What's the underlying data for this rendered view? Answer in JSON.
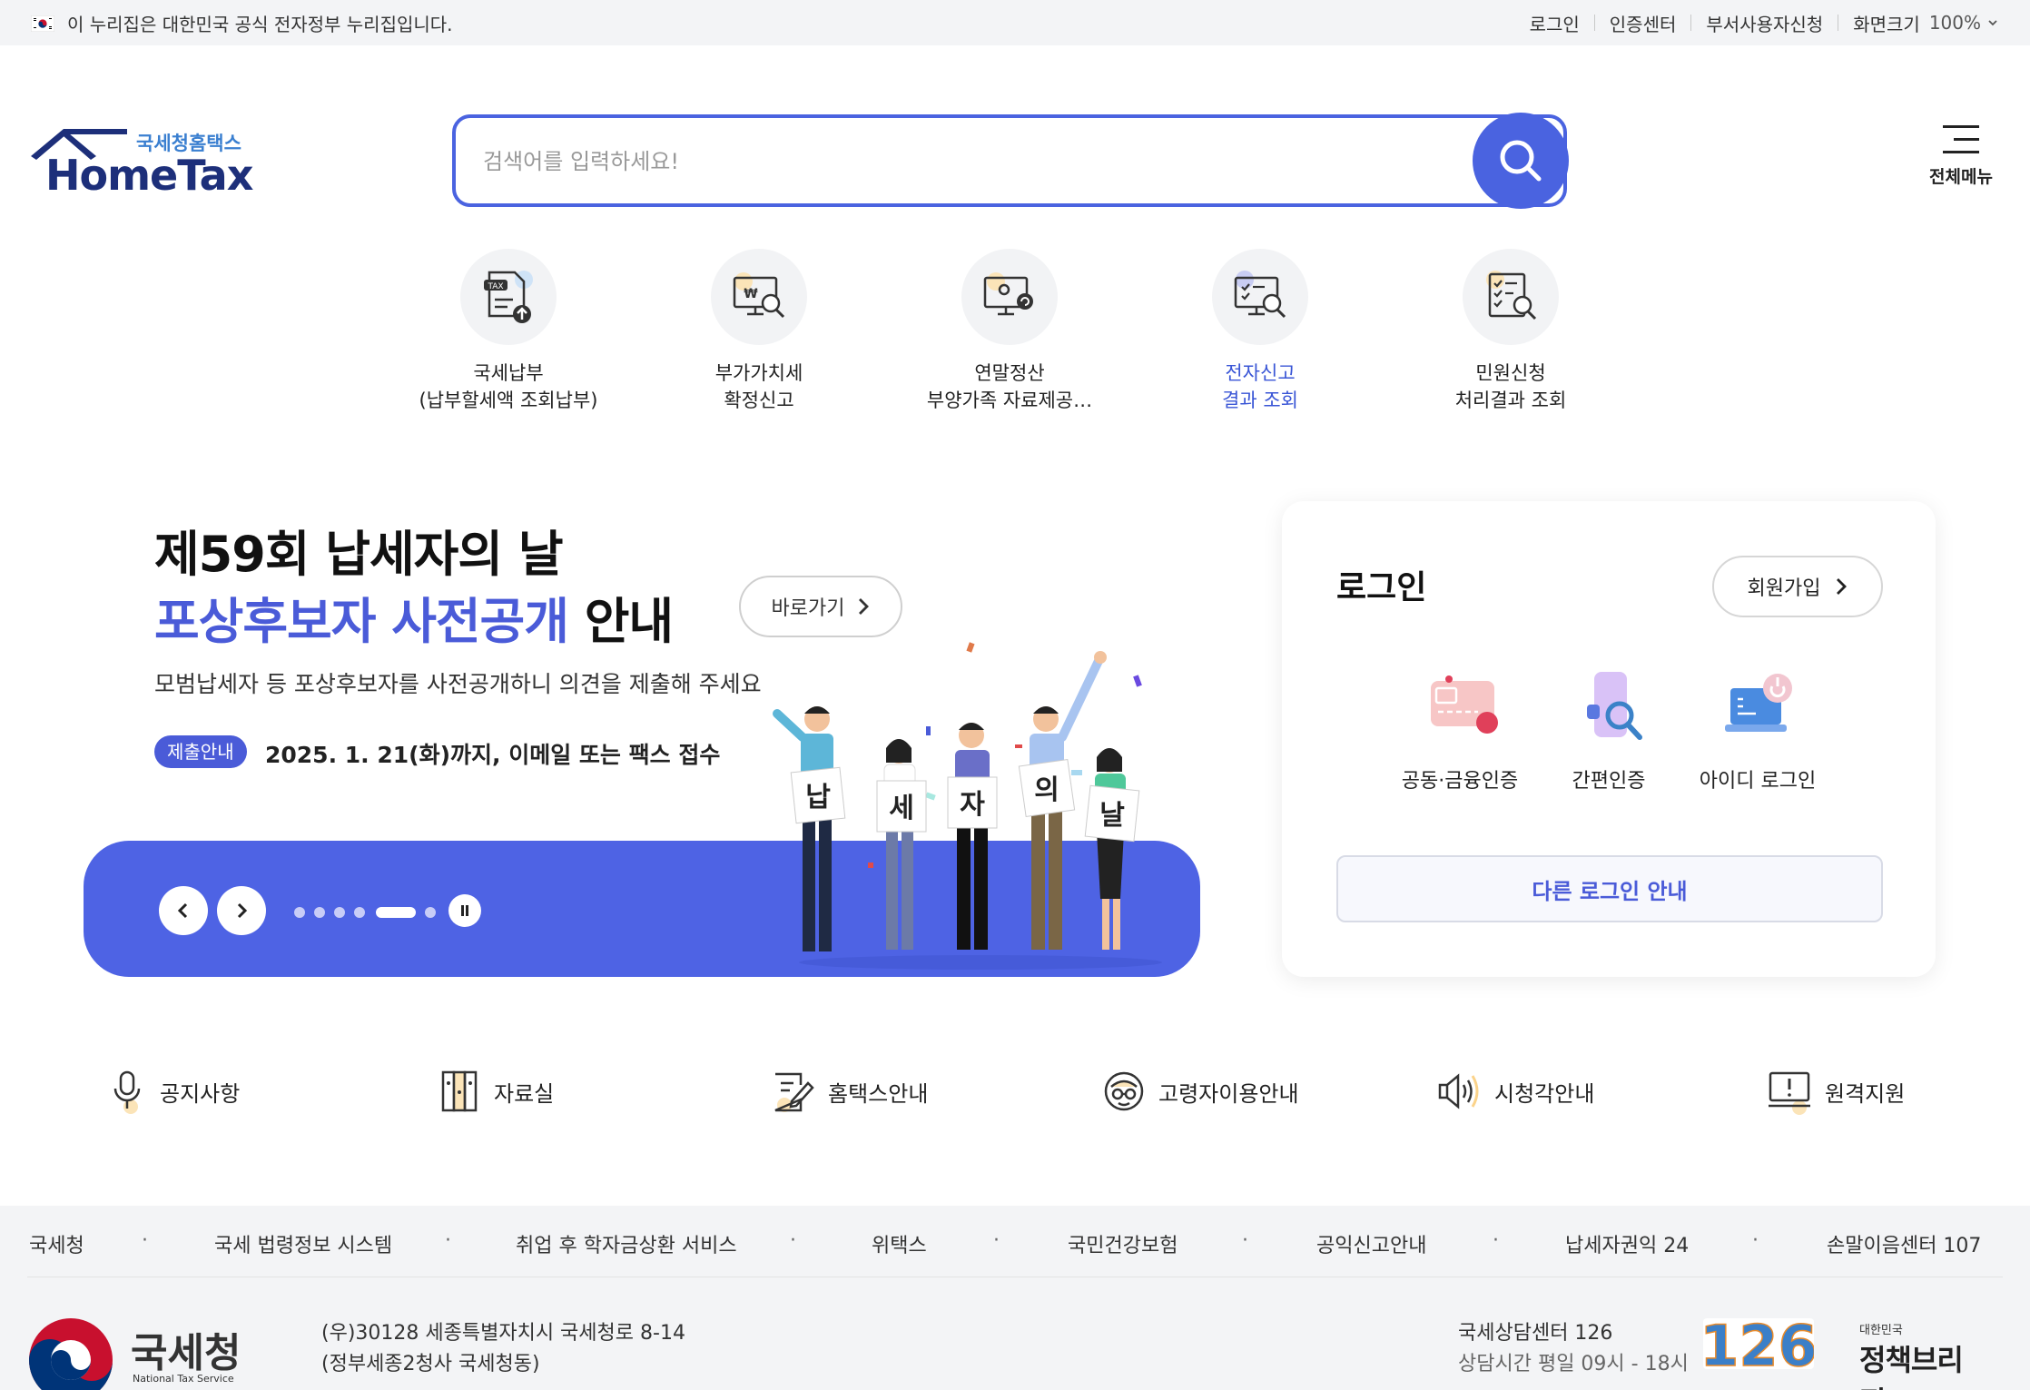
{
  "gov_bar": {
    "notice": "이 누리집은 대한민국 공식 전자정부 누리집입니다.",
    "links": [
      "로그인",
      "인증센터",
      "부서사용자신청"
    ],
    "zoom_label": "화면크기",
    "zoom_value": "100%"
  },
  "header": {
    "logo_sub": "국세청홈택스",
    "logo_main": "HomeTax",
    "search_placeholder": "검색어를 입력하세요!",
    "menu_label": "전체메뉴"
  },
  "quick_menu": [
    {
      "line1": "국세납부",
      "line2": "(납부할세액 조회납부)",
      "icon": "tax-payment-icon"
    },
    {
      "line1": "부가가치세",
      "line2": "확정신고",
      "icon": "vat-report-icon"
    },
    {
      "line1": "연말정산",
      "line2": "부양가족 자료제공…",
      "icon": "year-end-settlement-icon"
    },
    {
      "line1": "전자신고",
      "line2": "결과 조회",
      "icon": "e-filing-result-icon",
      "highlight": true
    },
    {
      "line1": "민원신청",
      "line2": "처리결과 조회",
      "icon": "civil-petition-icon"
    }
  ],
  "banner": {
    "title_line1": "제59회 납세자의 날",
    "title_line2_accent": "포상후보자 사전공개",
    "title_line2_rest": " 안내",
    "goto_label": "바로가기",
    "description": "모범납세자 등 포상후보자를 사전공개하니 의견을 제출해 주세요",
    "badge": "제출안내",
    "badge_text": "2025. 1. 21(화)까지, 이메일 또는 팩스 접수",
    "signs": [
      "납",
      "세",
      "자",
      "의",
      "날"
    ],
    "slide_count": 6,
    "active_slide": 5
  },
  "login": {
    "title": "로그인",
    "join_label": "회원가입",
    "methods": [
      {
        "label": "공동·금융인증",
        "icon": "certificate-icon"
      },
      {
        "label": "간편인증",
        "icon": "simple-auth-icon"
      },
      {
        "label": "아이디 로그인",
        "icon": "id-login-icon"
      }
    ],
    "other_label": "다른 로그인 안내"
  },
  "shortcuts": [
    {
      "label": "공지사항",
      "icon": "microphone-icon"
    },
    {
      "label": "자료실",
      "icon": "archive-icon"
    },
    {
      "label": "홈택스안내",
      "icon": "guide-icon"
    },
    {
      "label": "고령자이용안내",
      "icon": "senior-icon"
    },
    {
      "label": "시청각안내",
      "icon": "speaker-icon"
    },
    {
      "label": "원격지원",
      "icon": "remote-support-icon"
    }
  ],
  "footer_links": [
    "국세청",
    "국세 법령정보 시스템",
    "취업 후 학자금상환 서비스",
    "위택스",
    "국민건강보험",
    "공익신고안내",
    "납세자권익 24",
    "손말이음센터 107"
  ],
  "footer": {
    "org_name": "국세청",
    "org_eng": "National Tax Service",
    "address_line1": "(우)30128 세종특별자치시 국세청로 8-14",
    "address_line2": "(정부세종2청사 국세청동)",
    "center_title": "국세상담센터 126",
    "center_hours": "상담시간 평일 09시 - 18시",
    "logo_126": "126",
    "policy_small": "대한민국",
    "policy_big": "정책브리핑"
  },
  "colors": {
    "accent": "#4a5bd8",
    "banner_bar": "#4e63e4",
    "search_border": "#4a63e0"
  }
}
